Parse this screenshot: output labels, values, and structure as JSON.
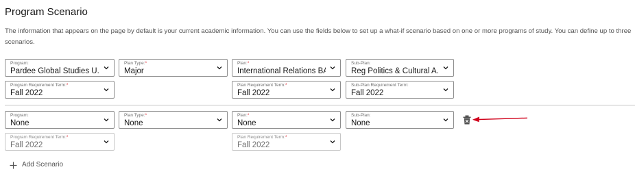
{
  "header": {
    "title": "Program Scenario",
    "description": "The information that appears on the page by default is your current academic information. You can use the fields below to set up a what-if scenario based on one or more programs of study. You can define up to three scenarios."
  },
  "scenario1": {
    "program": {
      "label": "Program:",
      "required": "",
      "value": "Pardee Global Studies U..."
    },
    "plan_type": {
      "label": "Plan Type:",
      "required": "*",
      "value": "Major"
    },
    "plan": {
      "label": "Plan:",
      "required": "*",
      "value": "International Relations BA"
    },
    "sub_plan": {
      "label": "Sub-Plan:",
      "required": "",
      "value": "Reg Politics & Cultural A..."
    },
    "program_term": {
      "label": "Program Requirement Term:",
      "required": "*",
      "value": "Fall 2022"
    },
    "plan_term": {
      "label": "Plan Requirement Term:",
      "required": "*",
      "value": "Fall 2022"
    },
    "sub_plan_term": {
      "label": "Sub-Plan Requirement Term:",
      "required": "",
      "value": "Fall 2022"
    }
  },
  "scenario2": {
    "program": {
      "label": "Program:",
      "required": "",
      "value": "None"
    },
    "plan_type": {
      "label": "Plan Type:",
      "required": "*",
      "value": "None"
    },
    "plan": {
      "label": "Plan:",
      "required": "*",
      "value": "None"
    },
    "sub_plan": {
      "label": "Sub-Plan:",
      "required": "",
      "value": "None"
    },
    "program_term": {
      "label": "Program Requirement Term:",
      "required": "*",
      "value": "Fall 2022"
    },
    "plan_term": {
      "label": "Plan Requirement Term:",
      "required": "*",
      "value": "Fall 2022"
    }
  },
  "actions": {
    "add_scenario": "Add Scenario"
  },
  "colors": {
    "annotation_arrow": "#d0021b",
    "required_marker": "#da1e28",
    "field_border": "#8d8d8d",
    "disabled_border": "#c6c6c6"
  },
  "icons": [
    "chevron-down-icon",
    "trash-icon",
    "plus-icon",
    "annotation-arrow-icon"
  ]
}
